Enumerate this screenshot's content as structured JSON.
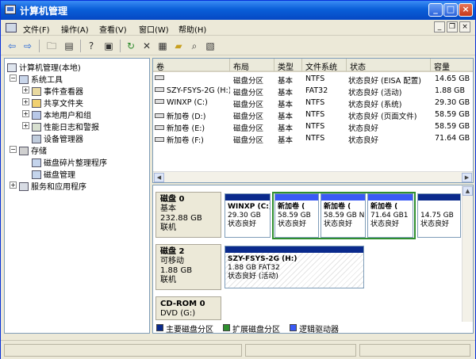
{
  "title": "计算机管理",
  "menu": [
    "文件(F)",
    "操作(A)",
    "查看(V)",
    "窗口(W)",
    "帮助(H)"
  ],
  "toolbar_icons": [
    "back-arrow-icon",
    "forward-arrow-icon",
    "up-folder-icon",
    "show-tree-icon",
    "help-icon",
    "properties-icon",
    "refresh-icon",
    "delete-icon",
    "new-icon",
    "open-icon",
    "search-icon",
    "export-icon"
  ],
  "tree": {
    "root": "计算机管理(本地)",
    "system_tools": "系统工具",
    "event_viewer": "事件查看器",
    "shared_folders": "共享文件夹",
    "local_users": "本地用户和组",
    "perf_logs": "性能日志和警报",
    "device_manager": "设备管理器",
    "storage": "存储",
    "defrag": "磁盘碎片整理程序",
    "disk_mgmt": "磁盘管理",
    "services": "服务和应用程序"
  },
  "volume_list": {
    "headers": [
      "卷",
      "布局",
      "类型",
      "文件系统",
      "状态",
      "容量"
    ],
    "rows": [
      {
        "name": "",
        "layout": "磁盘分区",
        "type": "基本",
        "fs": "NTFS",
        "status": "状态良好 (EISA 配置)",
        "capacity": "14.65 GB"
      },
      {
        "name": "SZY-FSYS-2G (H:)",
        "layout": "磁盘分区",
        "type": "基本",
        "fs": "FAT32",
        "status": "状态良好 (活动)",
        "capacity": "1.88 GB"
      },
      {
        "name": "WINXP (C:)",
        "layout": "磁盘分区",
        "type": "基本",
        "fs": "NTFS",
        "status": "状态良好 (系统)",
        "capacity": "29.30 GB"
      },
      {
        "name": "新加卷 (D:)",
        "layout": "磁盘分区",
        "type": "基本",
        "fs": "NTFS",
        "status": "状态良好 (页面文件)",
        "capacity": "58.59 GB"
      },
      {
        "name": "新加卷 (E:)",
        "layout": "磁盘分区",
        "type": "基本",
        "fs": "NTFS",
        "status": "状态良好",
        "capacity": "58.59 GB"
      },
      {
        "name": "新加卷 (F:)",
        "layout": "磁盘分区",
        "type": "基本",
        "fs": "NTFS",
        "status": "状态良好",
        "capacity": "71.64 GB"
      }
    ]
  },
  "disks": {
    "disk0": {
      "name": "磁盘 0",
      "type": "基本",
      "size": "232.88 GB",
      "state": "联机"
    },
    "disk0_parts": [
      {
        "name": "WINXP (C:)",
        "size": "29.30 GB",
        "status": "状态良好"
      },
      {
        "name": "新加卷 (",
        "size": "58.59 GB",
        "status": "状态良好"
      },
      {
        "name": "新加卷 (",
        "size": "58.59 GB N",
        "status": "状态良好"
      },
      {
        "name": "新加卷 (",
        "size": "71.64 GB1",
        "status": "状态良好"
      },
      {
        "name": "",
        "size": "14.75 GB",
        "status": "状态良好"
      }
    ],
    "disk2": {
      "name": "磁盘 2",
      "type": "可移动",
      "size": "1.88 GB",
      "state": "联机"
    },
    "disk2_part": {
      "name": "SZY-FSYS-2G (H:)",
      "size": "1.88 GB FAT32",
      "status": "状态良好 (活动)"
    },
    "cdrom": {
      "name": "CD-ROM 0",
      "drive": "DVD (G:)"
    }
  },
  "legend": [
    "主要磁盘分区",
    "扩展磁盘分区",
    "逻辑驱动器"
  ],
  "colors": {
    "primary": "#0a2a8c",
    "extended": "#2f8f2f",
    "logical": "#3a5af5"
  }
}
